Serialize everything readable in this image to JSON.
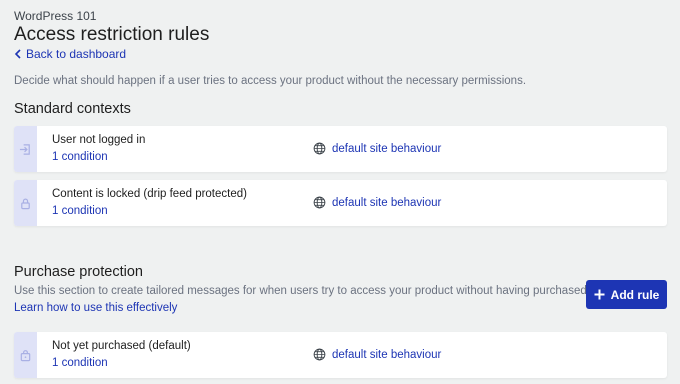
{
  "header": {
    "product_name": "WordPress 101",
    "title": "Access restriction rules",
    "back_label": "Back to dashboard",
    "description": "Decide what should happen if a user tries to access your product without the necessary permissions."
  },
  "standard_contexts": {
    "title": "Standard contexts",
    "items": [
      {
        "label": "User not logged in",
        "conditions": "1 condition",
        "behaviour": "default site behaviour",
        "icon": "sign-in-icon"
      },
      {
        "label": "Content is locked (drip feed protected)",
        "conditions": "1 condition",
        "behaviour": "default site behaviour",
        "icon": "lock-icon"
      }
    ]
  },
  "purchase_protection": {
    "title": "Purchase protection",
    "subtitle": "Use this section to create tailored messages for when users try to access your product without having purchased it",
    "learn_link": "Learn how to use this effectively",
    "add_rule_label": "Add rule",
    "items": [
      {
        "label": "Not yet purchased (default)",
        "conditions": "1 condition",
        "behaviour": "default site behaviour",
        "icon": "shopping-bag-icon"
      }
    ]
  },
  "colors": {
    "accent": "#1d35b4",
    "background": "#eff1f1",
    "icon_strip": "#dfe2f7"
  }
}
